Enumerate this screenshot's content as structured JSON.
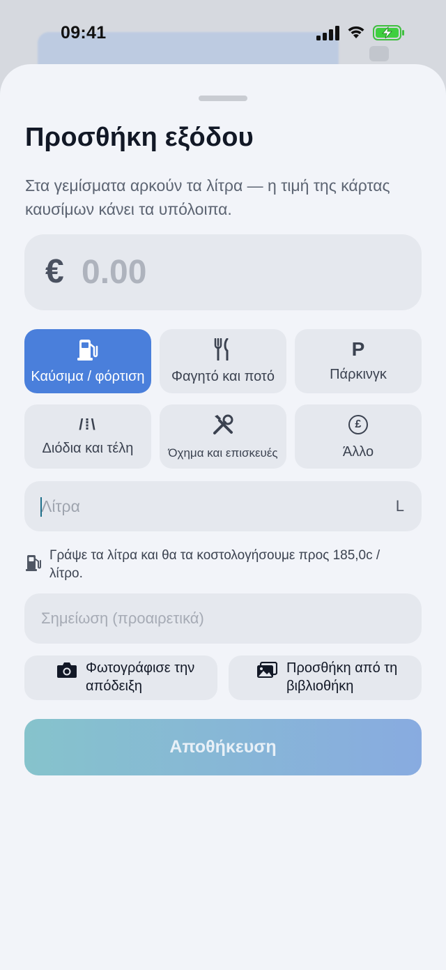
{
  "status_bar": {
    "time": "09:41"
  },
  "sheet": {
    "title": "Προσθήκη εξόδου",
    "subtitle": "Στα γεμίσματα αρκούν τα λίτρα — η τιμή της κάρτας καυσίμων κάνει τα υπόλοιπα."
  },
  "amount": {
    "currency": "€",
    "placeholder": "0.00",
    "value": ""
  },
  "categories": [
    {
      "label": "Καύσιμα / φόρτιση",
      "icon": "fuel-pump-icon",
      "selected": true
    },
    {
      "label": "Φαγητό και ποτό",
      "icon": "fork-knife-icon",
      "selected": false
    },
    {
      "label": "Πάρκινγκ",
      "icon": "parking-icon",
      "icon_text": "P",
      "selected": false
    },
    {
      "label": "Διόδια και τέλη",
      "icon": "road-icon",
      "icon_text": "/⁞\\",
      "selected": false
    },
    {
      "label": "Όχημα και επισκευές",
      "icon": "wrench-screwdriver-icon",
      "selected": false
    },
    {
      "label": "Άλλο",
      "icon": "pound-coin-icon",
      "icon_text": "£",
      "selected": false
    }
  ],
  "liters": {
    "placeholder": "Λίτρα",
    "value": "",
    "unit": "L"
  },
  "hint": {
    "icon": "fuel-pump-icon",
    "text": "Γράψε τα λίτρα και θα τα κοστολογήσουμε προς 185,0c / λίτρο."
  },
  "note": {
    "placeholder": "Σημείωση (προαιρετικά)",
    "value": ""
  },
  "receipt": {
    "camera_label": "Φωτογράφισε την απόδειξη",
    "library_label": "Προσθήκη από τη βιβλιοθήκη"
  },
  "save": {
    "label": "Αποθήκευση",
    "enabled": false
  },
  "colors": {
    "accent": "#4a7fdb",
    "sheet_bg": "#f2f4f9",
    "field_bg": "#e5e8ee",
    "save_gradient_start": "#86c3cc",
    "save_gradient_end": "#88abe0"
  }
}
